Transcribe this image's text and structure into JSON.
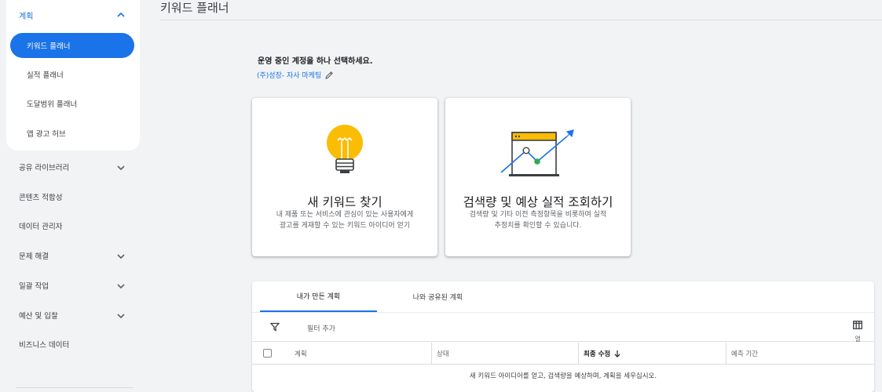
{
  "sidebar": {
    "group": {
      "label": "계획",
      "expanded": true
    },
    "sub_items": [
      {
        "label": "키워드 플래너",
        "active": true
      },
      {
        "label": "실적 플래너",
        "active": false
      },
      {
        "label": "도달범위 플래너",
        "active": false
      },
      {
        "label": "앱 광고 허브",
        "active": false
      }
    ],
    "nav_items": [
      {
        "label": "공유 라이브러리",
        "expandable": true
      },
      {
        "label": "콘텐츠 적합성",
        "expandable": false
      },
      {
        "label": "데이터 관리자",
        "expandable": false
      },
      {
        "label": "문제 해결",
        "expandable": true
      },
      {
        "label": "일괄 작업",
        "expandable": true
      },
      {
        "label": "예산 및 입찰",
        "expandable": true
      },
      {
        "label": "비즈니스 데이터",
        "expandable": false
      }
    ]
  },
  "main": {
    "title": "키워드 플래너",
    "select_prompt": "운영 중인 계정을 하나 선택하세요.",
    "account_name": "(주)성장- 자사 마케팅",
    "cards": [
      {
        "title": "새 키워드 찾기",
        "desc_line1": "내 제품 또는 서비스에 관심이 있는 사용자에게",
        "desc_line2": "광고를 게재할 수 있는 키워드 아이디어 얻기",
        "icon": "lightbulb-icon"
      },
      {
        "title": "검색량 및 예상 실적 조회하기",
        "desc_line1": "검색량 및 기타 이전 측정항목을 비롯하여 실적",
        "desc_line2": "추정치를 확인할 수 있습니다.",
        "icon": "trend-chart-icon"
      }
    ],
    "plans": {
      "tabs": [
        {
          "label": "내가 만든 계획",
          "active": true
        },
        {
          "label": "나와 공유된 계획",
          "active": false
        }
      ],
      "filter_placeholder": "필터 추가",
      "columns_label": "열",
      "headers": [
        "계획",
        "상태",
        "최종 수정",
        "예측 기간"
      ],
      "sorted_column": "최종 수정",
      "empty_message": "새 키워드 아이디어를 얻고, 검색량을 예상하며, 계획을 세우십시오."
    }
  },
  "colors": {
    "accent": "#1a73e8",
    "bulb": "#fbbc04",
    "green": "#34a853"
  }
}
